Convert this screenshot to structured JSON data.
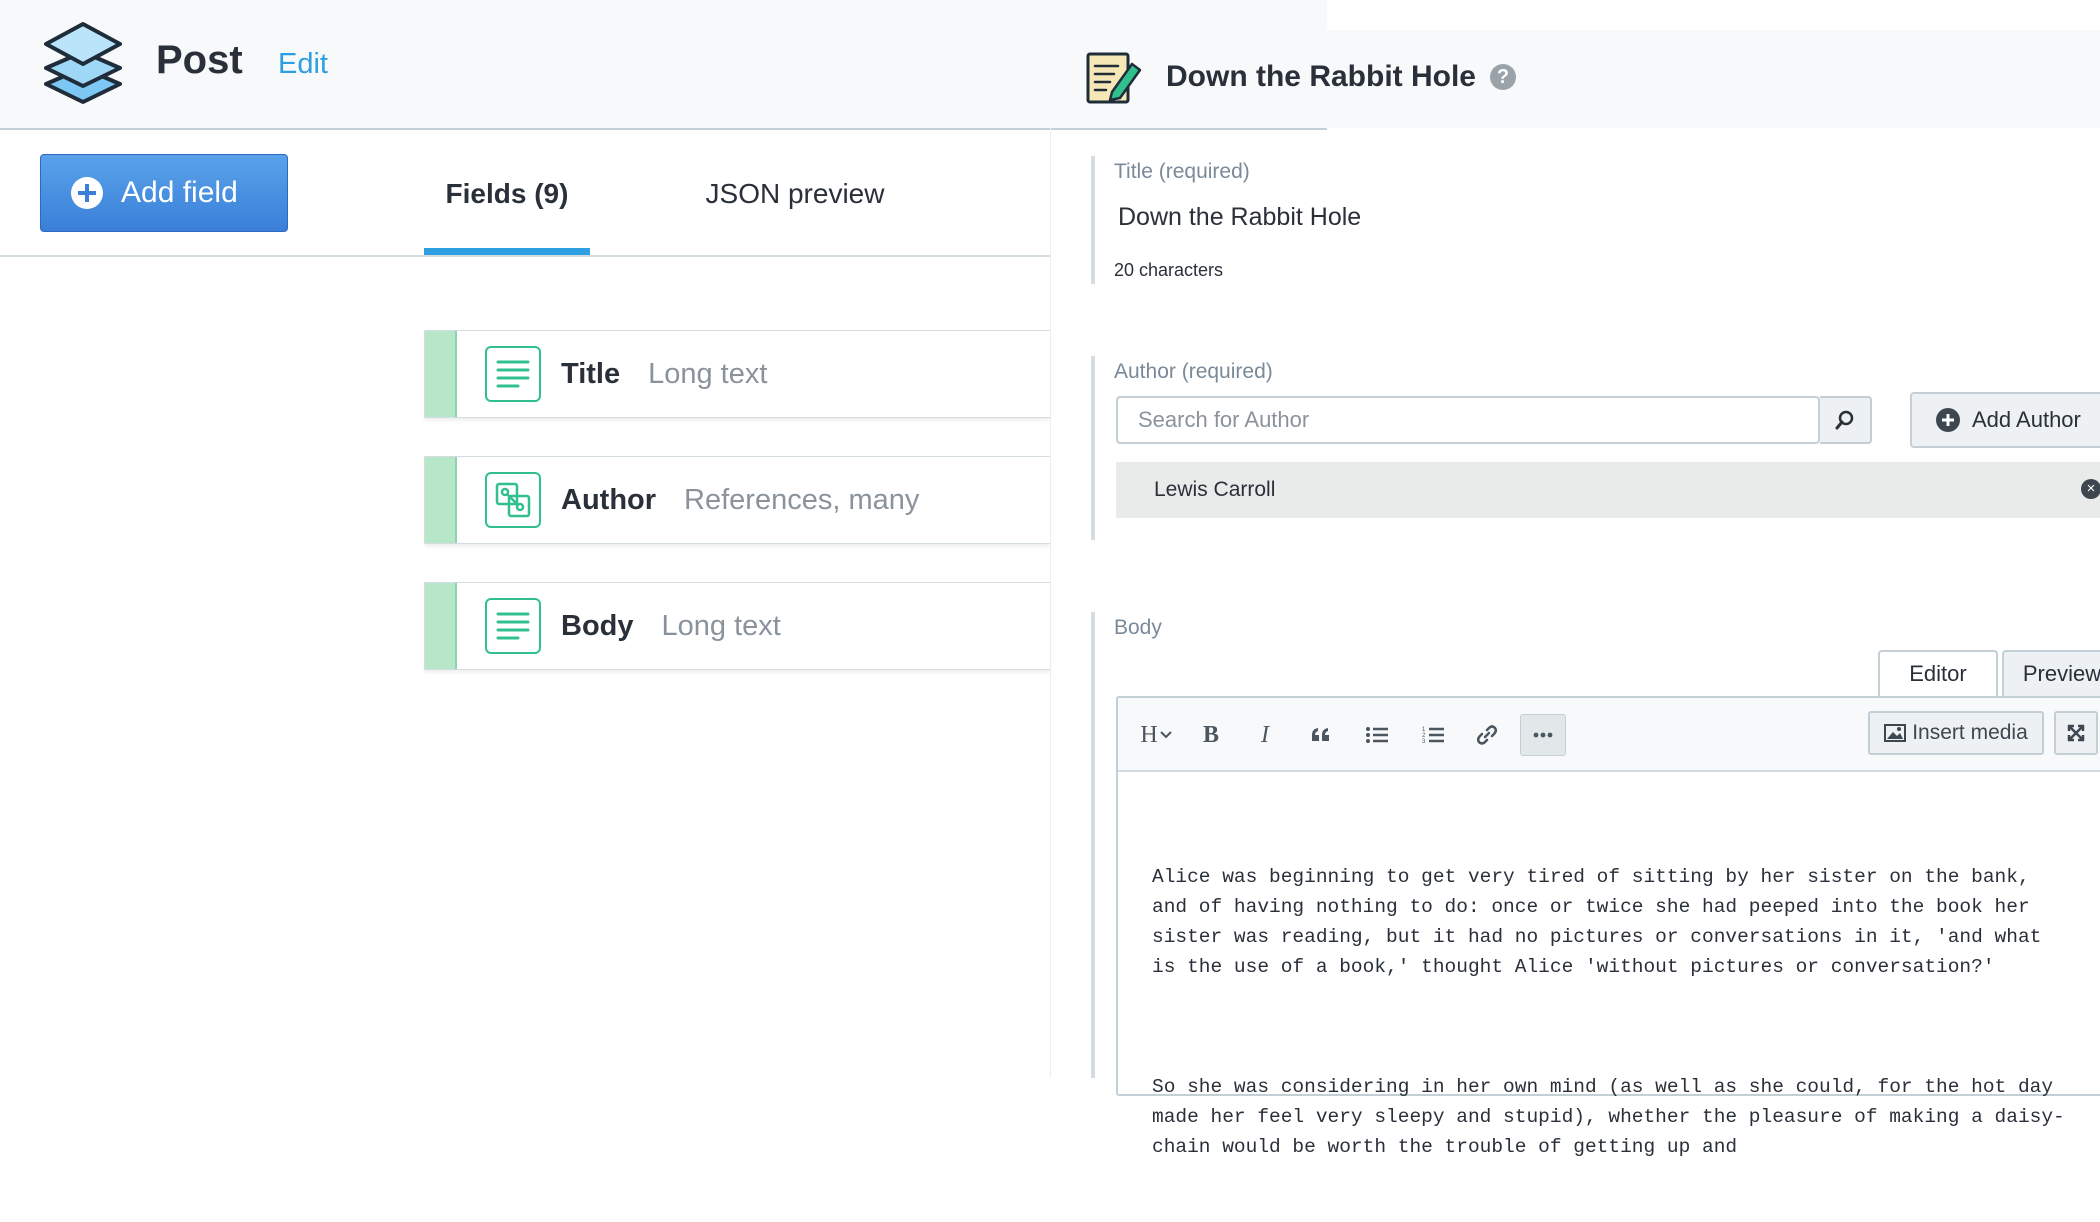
{
  "content_model": {
    "name": "Post",
    "edit_label": "Edit",
    "add_field_label": "Add field",
    "tabs": [
      {
        "label": "Fields (9)",
        "active": true
      },
      {
        "label": "JSON preview",
        "active": false
      }
    ],
    "fields": [
      {
        "name": "Title",
        "type": "Long text",
        "icon": "long-text-icon"
      },
      {
        "name": "Author",
        "type": "References, many",
        "icon": "references-icon"
      },
      {
        "name": "Body",
        "type": "Long text",
        "icon": "long-text-icon"
      }
    ]
  },
  "entry": {
    "title": "Down the Rabbit Hole",
    "icon": "entry-document-icon",
    "help_icon": "question-icon",
    "title_field": {
      "label": "Title (required)",
      "value": "Down the Rabbit Hole",
      "char_count": "20 characters"
    },
    "author_field": {
      "label": "Author (required)",
      "search_placeholder": "Search for Author",
      "add_label": "Add Author",
      "linked": [
        "Lewis Carroll"
      ]
    },
    "body_field": {
      "label": "Body",
      "view_tabs": [
        "Editor",
        "Preview"
      ],
      "toolbar": {
        "heading": "H",
        "bold": "B",
        "italic": "I",
        "insert_media": "Insert media"
      },
      "paragraphs": [
        "Alice was beginning to get very tired of sitting by her sister on the bank, and of having nothing to do: once or twice she had peeped into the book her sister was reading, but it had no pictures or conversations in it, 'and what is the use of a book,' thought Alice 'without pictures or conversation?'",
        "So she was considering in her own mind (as well as she could, for the hot day made her feel very sleepy and stupid), whether the pleasure of making a daisy- chain would be worth the trouble of getting up and"
      ]
    }
  },
  "colors": {
    "accent": "#2e9fe0",
    "primary_button": "#3a7fd8",
    "field_icon": "#2fc08d",
    "drag_handle": "#b8e6c9"
  }
}
